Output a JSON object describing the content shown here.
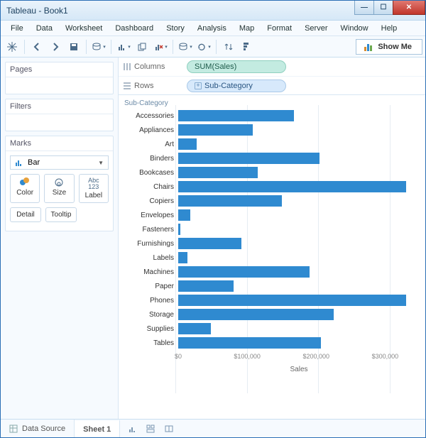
{
  "title": "Tableau - Book1",
  "menus": [
    "File",
    "Data",
    "Worksheet",
    "Dashboard",
    "Story",
    "Analysis",
    "Map",
    "Format",
    "Server",
    "Window",
    "Help"
  ],
  "showme_label": "Show Me",
  "sidebar": {
    "pages_title": "Pages",
    "filters_title": "Filters",
    "marks_title": "Marks",
    "marks_type": "Bar",
    "cards": {
      "color": "Color",
      "size": "Size",
      "label": "Label",
      "detail": "Detail",
      "tooltip": "Tooltip"
    }
  },
  "shelves": {
    "columns_label": "Columns",
    "rows_label": "Rows",
    "columns_pill": "SUM(Sales)",
    "rows_pill": "Sub-Category"
  },
  "bottom": {
    "datasource": "Data Source",
    "sheet": "Sheet 1"
  },
  "chart_data": {
    "type": "bar",
    "title": "Sub-Category",
    "xlabel": "Sales",
    "xlim": [
      0,
      350000
    ],
    "ticks": [
      0,
      100000,
      200000,
      300000
    ],
    "tick_labels": [
      "$0",
      "$100,000",
      "$200,000",
      "$300,000"
    ],
    "categories": [
      "Accessories",
      "Appliances",
      "Art",
      "Binders",
      "Bookcases",
      "Chairs",
      "Copiers",
      "Envelopes",
      "Fasteners",
      "Furnishings",
      "Labels",
      "Machines",
      "Paper",
      "Phones",
      "Storage",
      "Supplies",
      "Tables"
    ],
    "values": [
      168000,
      108000,
      27000,
      205000,
      115000,
      330000,
      150000,
      17000,
      3000,
      92000,
      13000,
      190000,
      80000,
      330000,
      225000,
      47000,
      207000
    ]
  }
}
